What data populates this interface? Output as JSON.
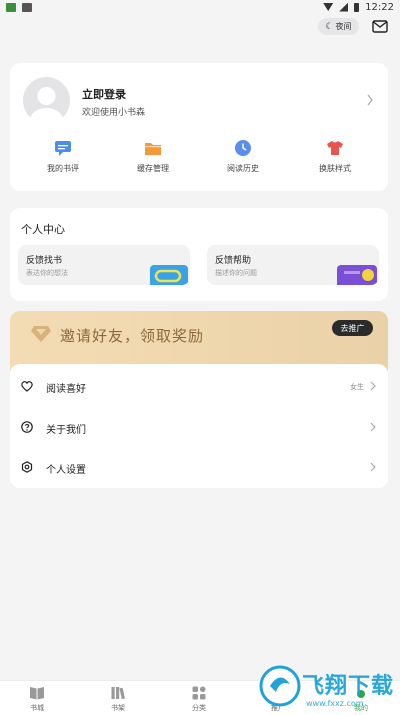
{
  "status_bar": {
    "time": "12:22"
  },
  "top": {
    "night_label": "夜间",
    "colors": {
      "accent_green": "#2ea44f"
    }
  },
  "profile": {
    "title": "立即登录",
    "subtitle": "欢迎使用小书森",
    "quick_links": [
      {
        "label": "我的书评",
        "icon": "comment-icon",
        "color": "#4a8fe7"
      },
      {
        "label": "缓存管理",
        "icon": "folder-icon",
        "color": "#f59a3c"
      },
      {
        "label": "阅读历史",
        "icon": "clock-icon",
        "color": "#5b8def"
      },
      {
        "label": "换肤样式",
        "icon": "shirt-icon",
        "color": "#e8554e"
      }
    ]
  },
  "center": {
    "title": "个人中心",
    "cards": [
      {
        "title": "反馈找书",
        "desc": "表达你的想法"
      },
      {
        "title": "反馈帮助",
        "desc": "描述你的问题"
      }
    ]
  },
  "invite": {
    "text": "邀请好友，领取奖励",
    "button": "去推广"
  },
  "menu": {
    "items": [
      {
        "label": "阅读喜好",
        "value": "女生",
        "icon": "heart-icon"
      },
      {
        "label": "关于我们",
        "value": "",
        "icon": "help-icon"
      },
      {
        "label": "个人设置",
        "value": "",
        "icon": "settings-icon"
      }
    ]
  },
  "bottom_nav": {
    "items": [
      {
        "label": "书城"
      },
      {
        "label": "书架"
      },
      {
        "label": "分类"
      },
      {
        "label": "推广"
      },
      {
        "label": "我的"
      }
    ],
    "active": "我的"
  },
  "watermark": {
    "text": "飞翔下载",
    "url": "www.fxxz.com"
  }
}
